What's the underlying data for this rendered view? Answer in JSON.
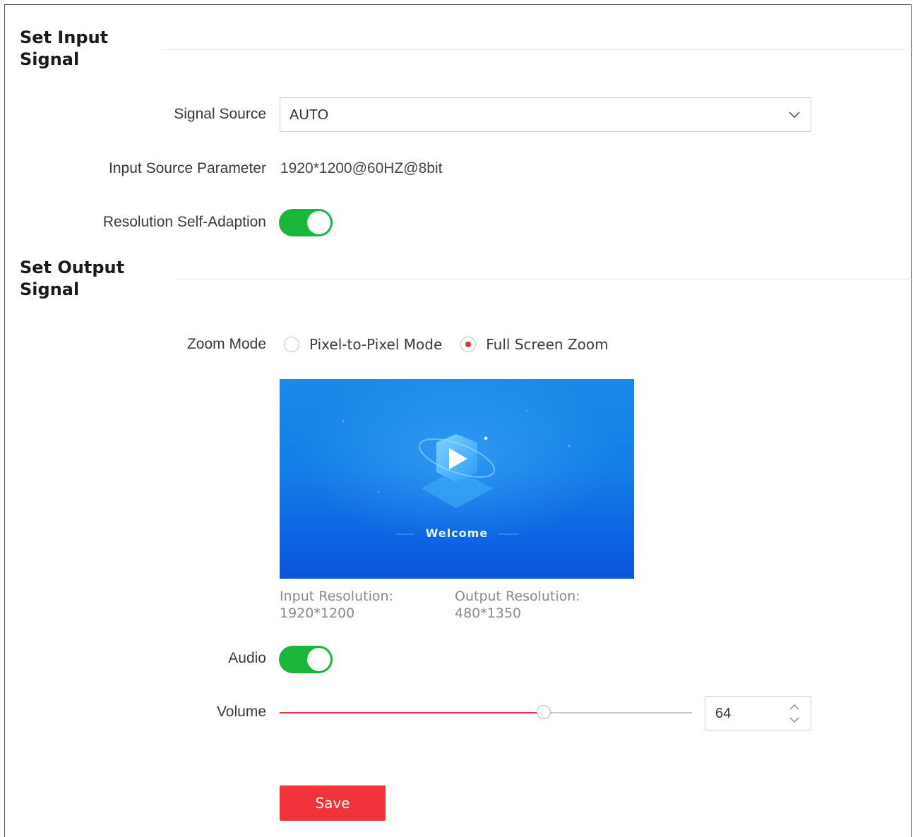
{
  "input_section": {
    "title_line1": "Set Input",
    "title_line2": "Signal",
    "signal_source_label": "Signal Source",
    "signal_source_value": "AUTO",
    "input_param_label": "Input Source Parameter",
    "input_param_value": "1920*1200@60HZ@8bit",
    "res_adapt_label": "Resolution Self-Adaption",
    "res_adapt_on": true
  },
  "output_section": {
    "title_line1": "Set Output",
    "title_line2": "Signal",
    "zoom_mode_label": "Zoom Mode",
    "zoom_options": [
      {
        "label": "Pixel-to-Pixel Mode",
        "checked": false
      },
      {
        "label": "Full Screen Zoom",
        "checked": true
      }
    ],
    "preview_text": "Welcome",
    "input_res_label": "Input Resolution:",
    "input_res_value": "1920*1200",
    "output_res_label": "Output Resolution:",
    "output_res_value": "480*1350",
    "audio_label": "Audio",
    "audio_on": true,
    "volume_label": "Volume",
    "volume_value": "64",
    "volume_slider_fraction": 0.64
  },
  "actions": {
    "save_label": "Save"
  },
  "colors": {
    "accent": "#e8303b",
    "toggle_on": "#19b63a",
    "save_button": "#f1343c"
  },
  "icons": {
    "select_arrow": "chevron-down-icon",
    "spinner": "spinner-arrows-icon",
    "preview_logo": "play-logo-icon"
  }
}
